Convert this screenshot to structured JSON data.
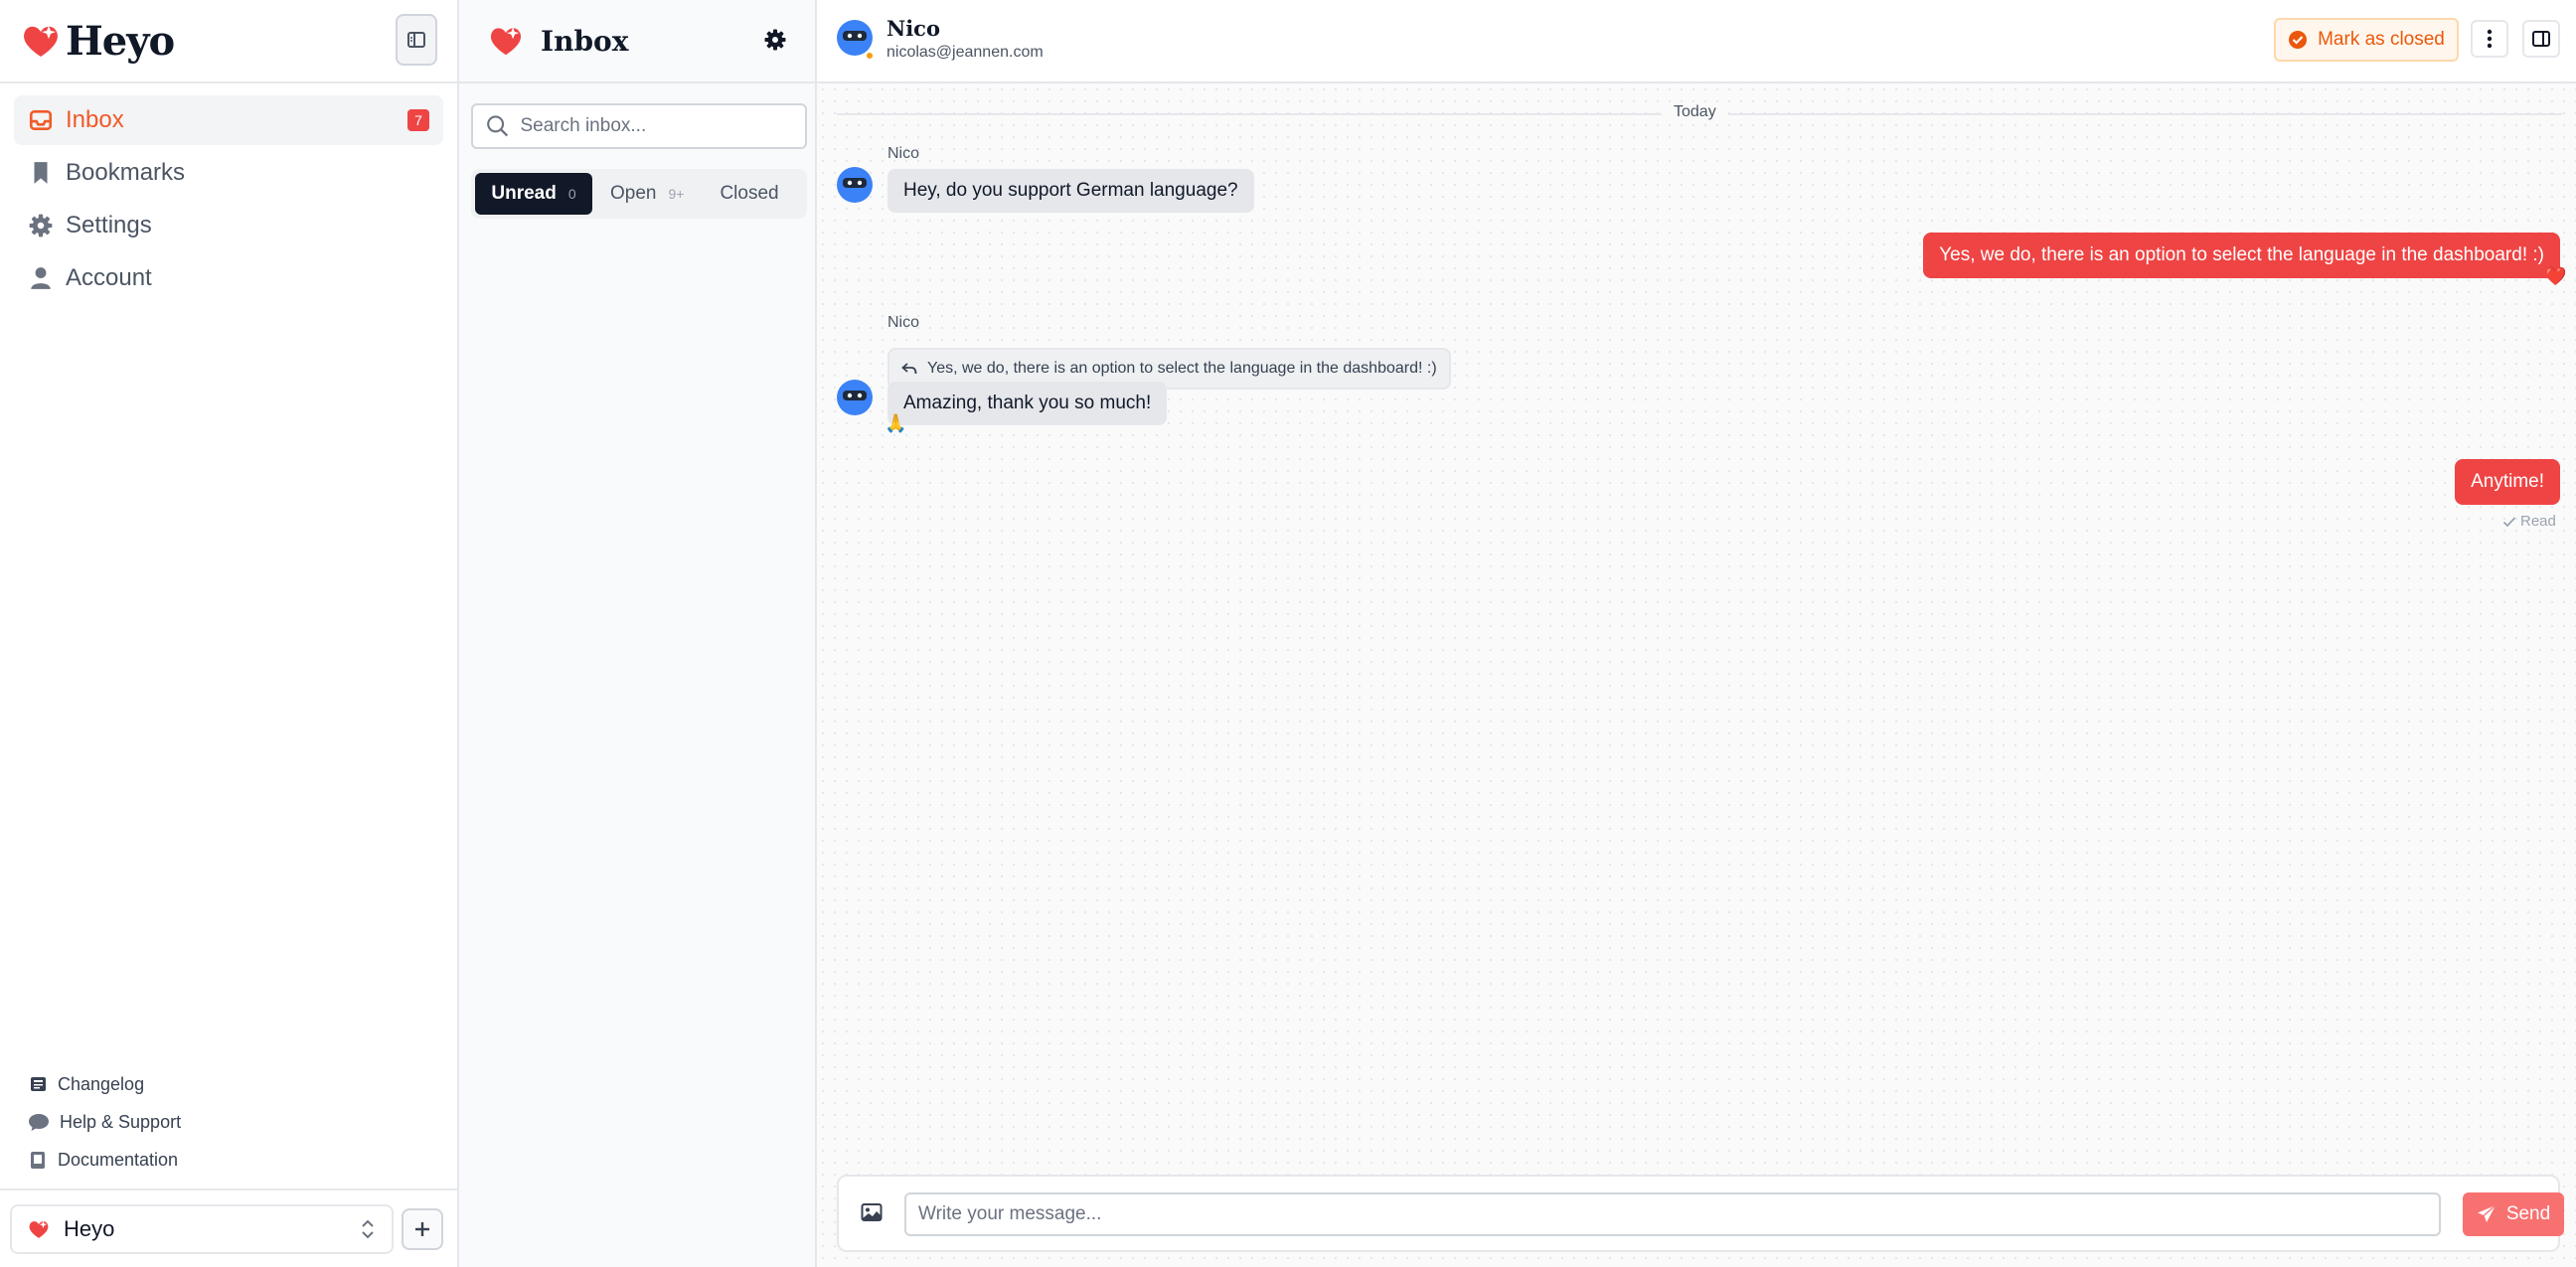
{
  "app": {
    "name": "Heyo",
    "brand_color": "#f05a28",
    "accent_color": "#ef4444"
  },
  "sidebar": {
    "items": [
      {
        "label": "Inbox",
        "icon": "inbox-icon",
        "badge": "7",
        "active": true
      },
      {
        "label": "Bookmarks",
        "icon": "bookmark-icon"
      },
      {
        "label": "Settings",
        "icon": "gear-icon"
      },
      {
        "label": "Account",
        "icon": "user-icon"
      }
    ],
    "footer_links": [
      {
        "label": "Changelog",
        "icon": "newspaper-icon"
      },
      {
        "label": "Help & Support",
        "icon": "chat-bubble-icon"
      },
      {
        "label": "Documentation",
        "icon": "book-icon"
      }
    ],
    "workspace": {
      "name": "Heyo"
    }
  },
  "inbox": {
    "title": "Inbox",
    "search_placeholder": "Search inbox...",
    "tabs": [
      {
        "label": "Unread",
        "count": "0",
        "active": true
      },
      {
        "label": "Open",
        "count": "9+"
      },
      {
        "label": "Closed",
        "count": ""
      }
    ]
  },
  "conversation": {
    "contact": {
      "name": "Nico",
      "email": "nicolas@jeannen.com",
      "status_color": "#f59e0b"
    },
    "mark_closed_label": "Mark as closed",
    "day_label": "Today",
    "messages": [
      {
        "direction": "in",
        "sender": "Nico",
        "text": "Hey, do you support German language?"
      },
      {
        "direction": "out",
        "text": "Yes, we do, there is an option to select the language in the dashboard! :)",
        "reaction": "❤️"
      },
      {
        "direction": "in",
        "sender": "Nico",
        "reply_to": "Yes, we do, there is an option to select the language in the dashboard! :)",
        "text": "Amazing, thank you so much!",
        "reaction": "🙏"
      },
      {
        "direction": "out",
        "text": "Anytime!",
        "status": "Read"
      }
    ],
    "composer": {
      "placeholder": "Write your message...",
      "send_label": "Send"
    }
  }
}
